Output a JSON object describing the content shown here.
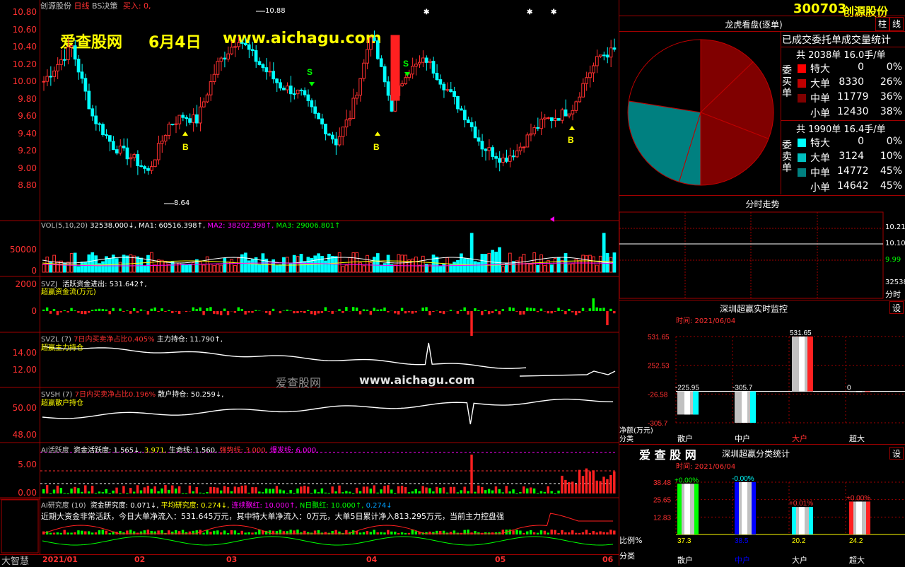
{
  "header": {
    "stock_name": "创源股份",
    "period": "日线",
    "strategy": "BS决策",
    "buy_label": "买入: 0,"
  },
  "watermark": {
    "site_cn": "爱查股网",
    "date": "6月4日",
    "url": "www.aichagu.com",
    "mid_cn": "爱查股网",
    "mid_url": "www.aichagu.com"
  },
  "main_chart": {
    "y_ticks": [
      "10.80",
      "10.60",
      "10.40",
      "10.20",
      "10.00",
      "9.80",
      "9.60",
      "9.40",
      "9.20",
      "9.00",
      "8.80"
    ],
    "high_label": "10.88",
    "low_label": "8.64",
    "marker_b": "B",
    "marker_s": "S"
  },
  "vol_pane": {
    "title": "VOL(5,10,20)",
    "value": "32538.000↓,",
    "ma1": "MA1: 60516.398↑,",
    "ma2": "MA2: 38202.398↑,",
    "ma3": "MA3: 29006.801↑",
    "y_ticks": [
      "50000",
      "0"
    ]
  },
  "svzj_pane": {
    "title": "SVZJ",
    "line1": "活跃资金进出: 531.642↑,",
    "line2": "超赢资金流(万元)",
    "y_ticks": [
      "2000",
      "0"
    ]
  },
  "svzl_pane": {
    "title": "SVZL (7)",
    "desc": "7日内买卖净占比0.405%",
    "hold": "主力持仓: 11.790↑,",
    "line2": "超赢主力持仓",
    "y_ticks": [
      "14.00",
      "12.00"
    ]
  },
  "svsh_pane": {
    "title": "SVSH (7)",
    "desc": "7日内买卖净占比0.196%",
    "hold": "散户持仓: 50.259↓,",
    "line2": "超赢散户持仓",
    "y_ticks": [
      "50.00",
      "48.00"
    ]
  },
  "ai_active": {
    "title": "AI活跃度",
    "v1": "资金活跃度: 1.565↓,",
    "v2": "3.971,",
    "v3": "生命线: 1.560,",
    "v4": "强势线: 3.000,",
    "v5": "爆发线: 6.000,",
    "y_ticks": [
      "5.00",
      "0.00"
    ]
  },
  "ai_research": {
    "title": "AI研究度 (10)",
    "v1": "资金研究度: 0.071↓,",
    "v2": "平均研究度: 0.274↓,",
    "v3": "连续飘红: 10.000↑,",
    "v4": "N日飘红: 10.000↑,",
    "v5": "0.274↓",
    "summary": "近期大资金非常活跃，今日大单净流入：531.645万元，其中特大单净流入：0万元，大单5日累计净入813.295万元，当前主力控盘强"
  },
  "bottom_bar": {
    "app_name": "大智慧",
    "dates": [
      "2021/01",
      "02",
      "03",
      "04",
      "05",
      "06"
    ]
  },
  "right": {
    "code": "300703",
    "name": "创源股份",
    "btn_zhu": "柱",
    "btn_xian": "线",
    "lhkp_title": "龙虎看盘(逐单)",
    "stat_title": "已成交委托单成交量统计",
    "buy_side_label": "委买单",
    "buy_total": "共 2038单 16.0手/单",
    "buy_rows": [
      {
        "label": "特大",
        "count": "0",
        "pct": "0%"
      },
      {
        "label": "大单",
        "count": "8330",
        "pct": "26%"
      },
      {
        "label": "中单",
        "count": "11779",
        "pct": "36%"
      },
      {
        "label": "小单",
        "count": "12430",
        "pct": "38%"
      }
    ],
    "sell_side_label": "委卖单",
    "sell_total": "共 1990单 16.4手/单",
    "sell_rows": [
      {
        "label": "特大",
        "count": "0",
        "pct": "0%"
      },
      {
        "label": "大单",
        "count": "3124",
        "pct": "10%"
      },
      {
        "label": "中单",
        "count": "14772",
        "pct": "45%"
      },
      {
        "label": "小单",
        "count": "14642",
        "pct": "45%"
      }
    ],
    "fenshi_title": "分时走势",
    "fenshi_y": [
      "10.21",
      "10.10",
      "9.99"
    ],
    "fenshi_vol": "32538",
    "fenshi_label": "分时",
    "monitor_title": "深圳超赢实时监控",
    "monitor_btn": "设",
    "monitor_time": "时间: 2021/06/04",
    "monitor_y": [
      "531.65",
      "252.53",
      "-26.58",
      "-305.7"
    ],
    "monitor_ylabel": "净额(万元)",
    "monitor_xlabel": "分类",
    "monitor_cats": [
      "散户",
      "中户",
      "大户",
      "超大"
    ],
    "monitor_values": [
      "-225.95",
      "-305.7",
      "531.65",
      "0"
    ],
    "class_brand": "爱 查 股 网",
    "class_title": "深圳超赢分类统计",
    "class_btn": "设",
    "class_time": "时间: 2021/06/04",
    "class_y": [
      "38.48",
      "25.65",
      "12.83",
      "0"
    ],
    "class_ylabel": "比例%",
    "class_xlabel": "分类",
    "class_cats": [
      "散户",
      "中户",
      "大户",
      "超大"
    ],
    "class_values": [
      "37.3",
      "38.5",
      "20.2",
      "24.2"
    ],
    "class_changes": [
      "+0.00%",
      "-0.00%",
      "+0.01%",
      "+0.00%"
    ],
    "colors": {
      "red": "#ff2020",
      "cyan": "#00ffff",
      "dark_red": "#800000",
      "teal": "#008080",
      "yellow": "#ffff00"
    }
  },
  "chart_data": [
    {
      "type": "pie",
      "title": "龙虎看盘(逐单)",
      "categories": [
        "买-大单",
        "买-中单",
        "买-小单",
        "卖-大单",
        "卖-中单",
        "卖-小单"
      ],
      "values": [
        8330,
        11779,
        12430,
        3124,
        14772,
        14642
      ]
    },
    {
      "type": "bar",
      "title": "深圳超赢实时监控",
      "categories": [
        "散户",
        "中户",
        "大户",
        "超大"
      ],
      "values": [
        -225.95,
        -305.7,
        531.65,
        0
      ],
      "ylabel": "净额(万元)",
      "ylim": [
        -305.7,
        531.65
      ]
    },
    {
      "type": "bar",
      "title": "深圳超赢分类统计",
      "categories": [
        "散户",
        "中户",
        "大户",
        "超大"
      ],
      "values": [
        37.3,
        38.5,
        20.2,
        24.2
      ],
      "ylabel": "比例%",
      "ylim": [
        0,
        38.48
      ]
    }
  ]
}
